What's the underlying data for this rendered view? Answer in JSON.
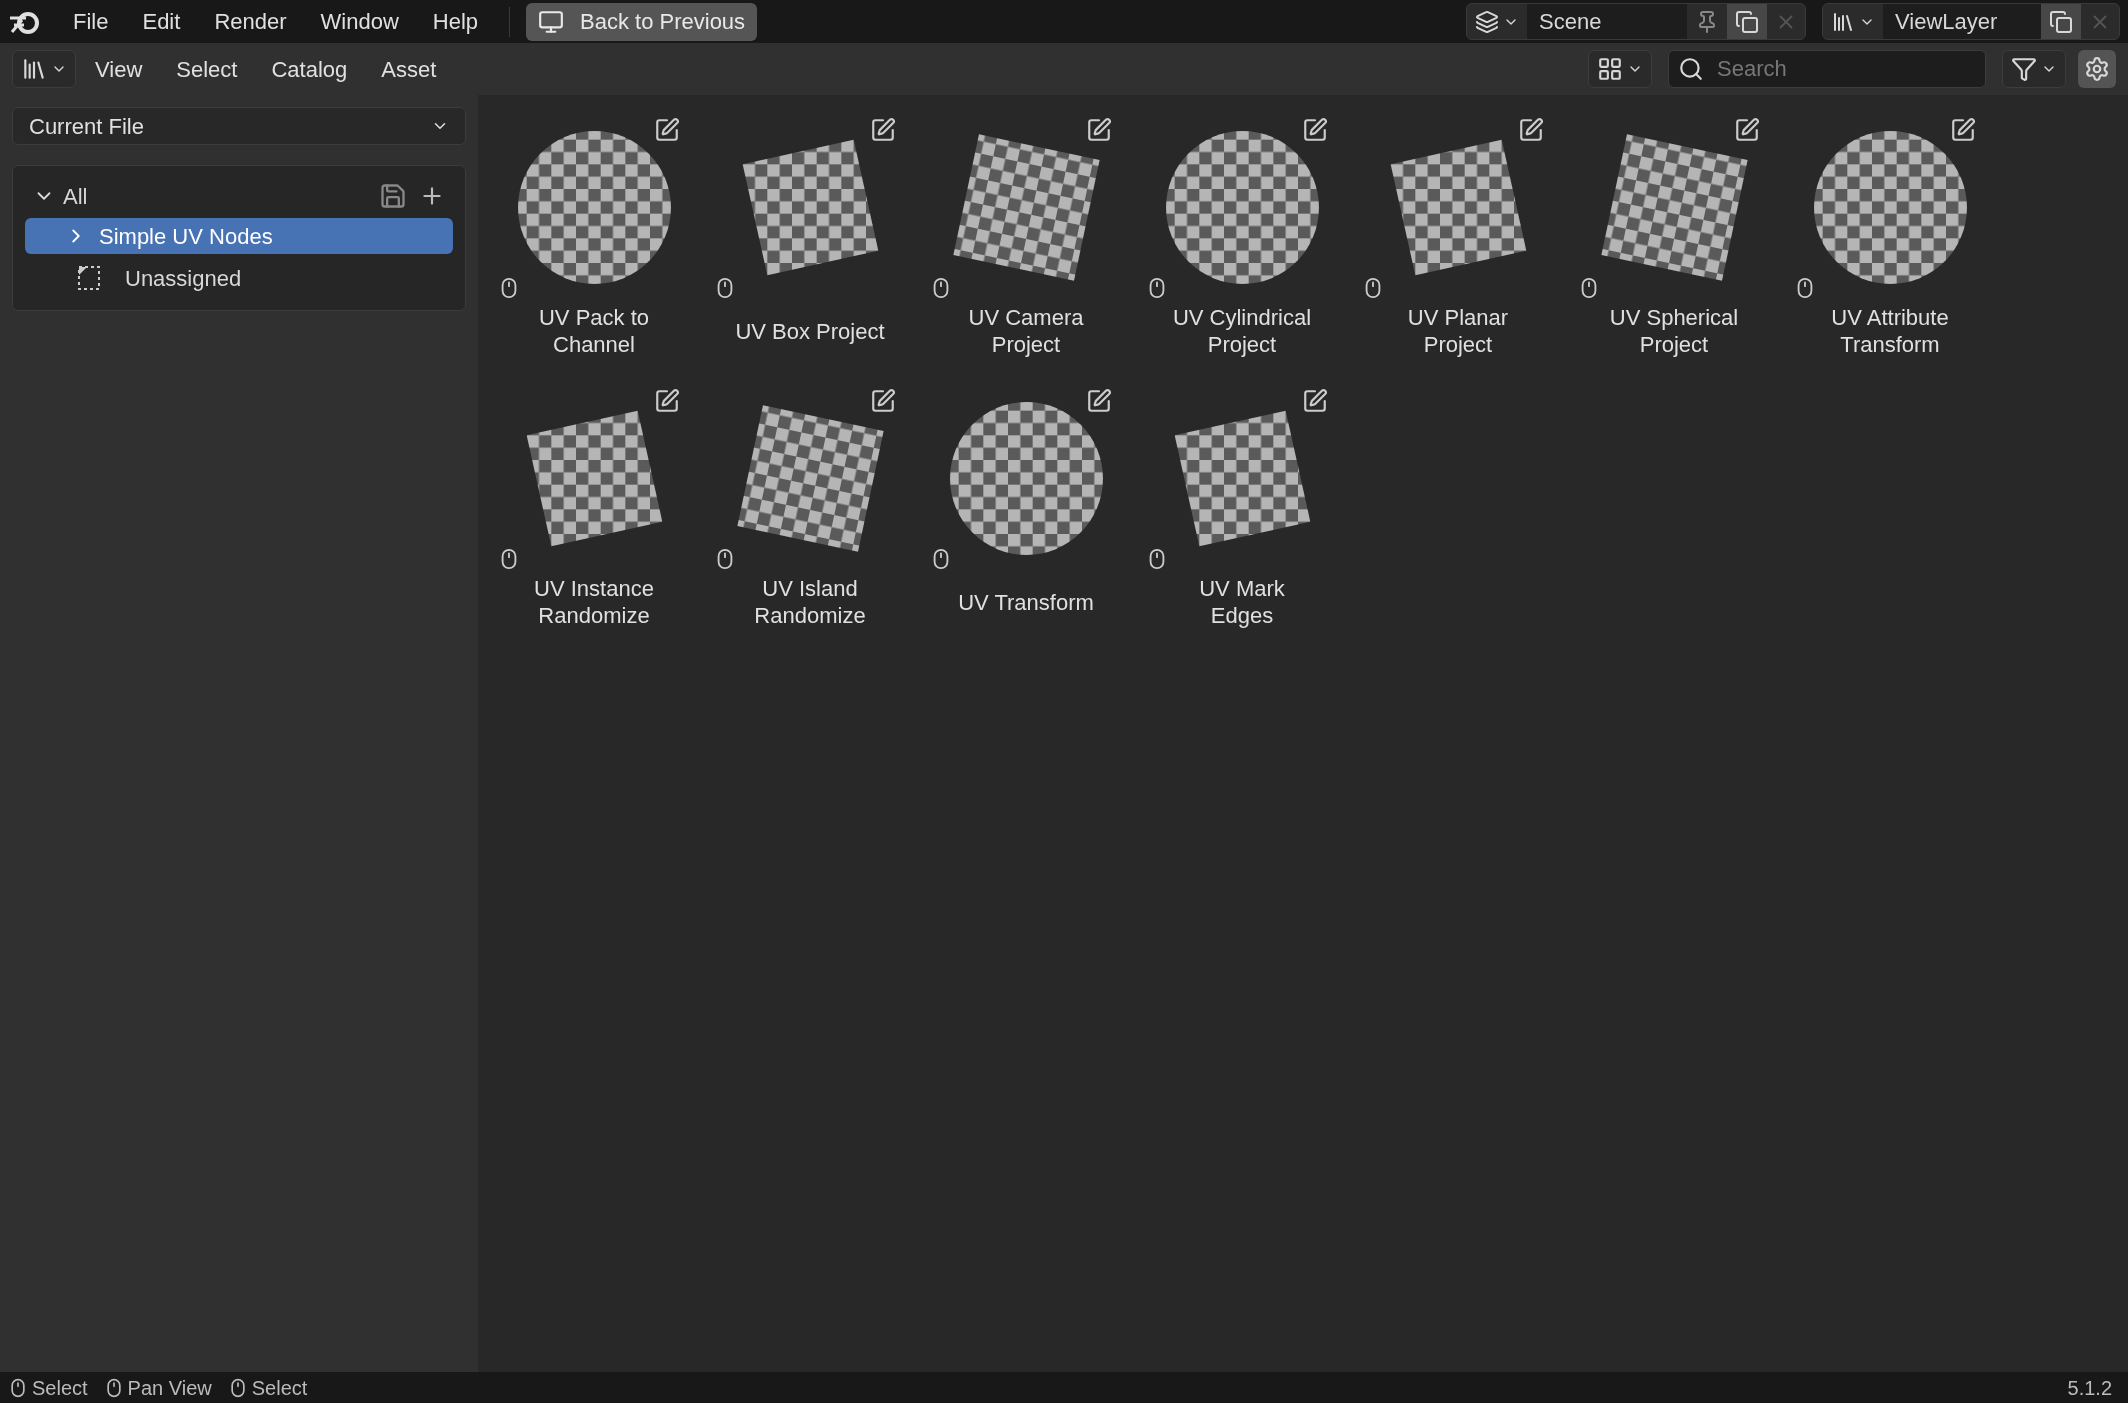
{
  "menu": [
    "File",
    "Edit",
    "Render",
    "Window",
    "Help"
  ],
  "back_button": "Back to Previous",
  "scene": {
    "name": "Scene"
  },
  "view_layer": {
    "name": "ViewLayer"
  },
  "header_menus": [
    "View",
    "Select",
    "Catalog",
    "Asset"
  ],
  "search": {
    "placeholder": "Search"
  },
  "library": "Current File",
  "catalog_tree": {
    "label": "All",
    "expanded": true,
    "children": [
      {
        "label": "Simple UV Nodes",
        "selected": true,
        "expanded": false
      }
    ]
  },
  "unassigned": {
    "label": "Unassigned",
    "selected": false
  },
  "assets": [
    {
      "name": "UV Pack to Channel"
    },
    {
      "name": "UV Box Project"
    },
    {
      "name": "UV Camera Project"
    },
    {
      "name": "UV Cylindrical Project"
    },
    {
      "name": "UV Planar Project"
    },
    {
      "name": "UV Spherical Project"
    },
    {
      "name": "UV Attribute Transform"
    },
    {
      "name": "UV Instance Randomize"
    },
    {
      "name": "UV Island Randomize"
    },
    {
      "name": "UV Transform"
    },
    {
      "name": "UV Mark Edges"
    }
  ],
  "status_bar": {
    "hints": [
      "Select",
      "Pan View",
      "Select"
    ],
    "version": "5.1.2"
  }
}
